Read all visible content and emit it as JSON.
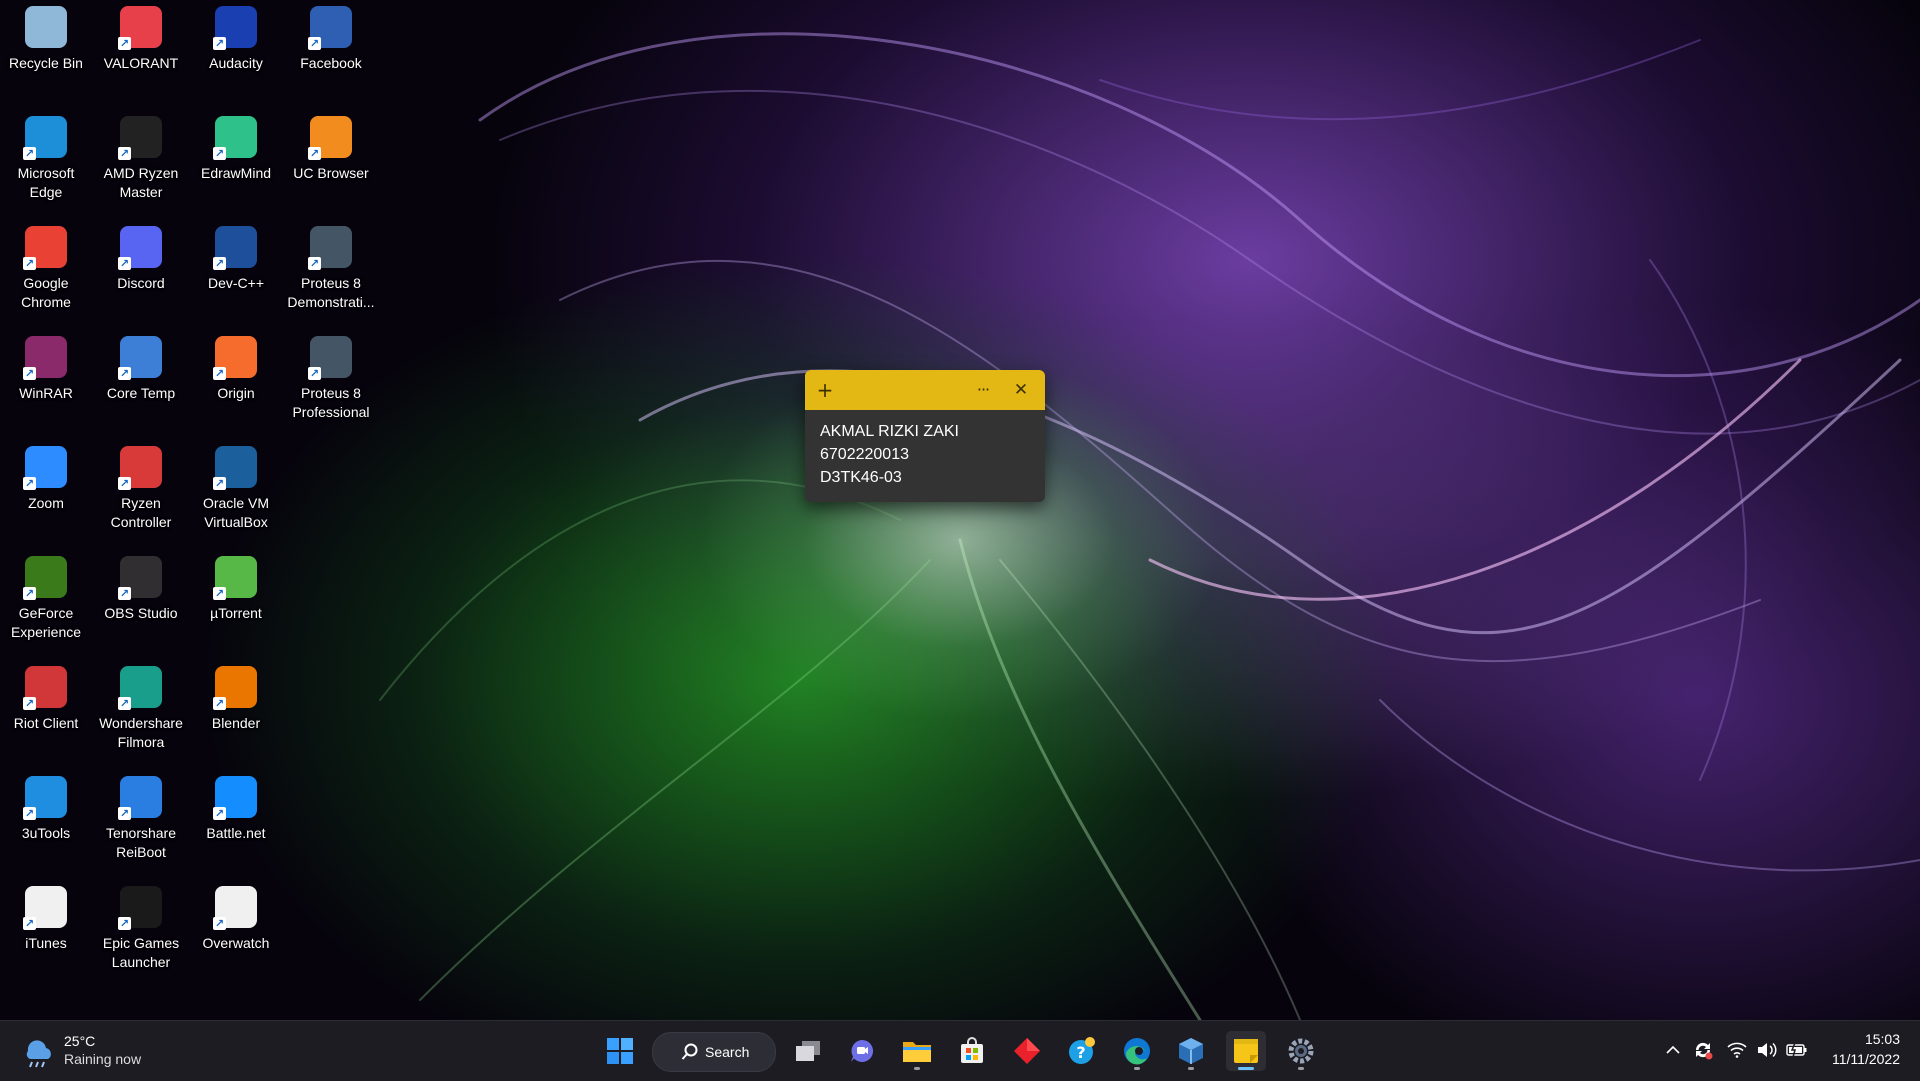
{
  "desktop": {
    "icons": [
      {
        "label": "Recycle Bin",
        "icon": "recycle-bin-icon",
        "color": "#8fb8d8"
      },
      {
        "label": "VALORANT",
        "icon": "valorant-icon",
        "color": "#e8404a"
      },
      {
        "label": "Audacity",
        "icon": "audacity-icon",
        "color": "#1a3fb0"
      },
      {
        "label": "Facebook",
        "icon": "facebook-icon",
        "color": "#2f5fb3"
      },
      {
        "label": "Microsoft Edge",
        "icon": "edge-icon",
        "color": "#1c8fd8"
      },
      {
        "label": "AMD Ryzen Master",
        "icon": "ryzen-master-icon",
        "color": "#222222"
      },
      {
        "label": "EdrawMind",
        "icon": "edrawmind-icon",
        "color": "#2ec28a"
      },
      {
        "label": "UC Browser",
        "icon": "uc-browser-icon",
        "color": "#f28c1e"
      },
      {
        "label": "Google Chrome",
        "icon": "chrome-icon",
        "color": "#e94235"
      },
      {
        "label": "Discord",
        "icon": "discord-icon",
        "color": "#5865f2"
      },
      {
        "label": "Dev-C++",
        "icon": "devcpp-icon",
        "color": "#1e4f9a"
      },
      {
        "label": "Proteus 8 Demonstrati...",
        "icon": "proteus-demo-icon",
        "color": "#445566"
      },
      {
        "label": "WinRAR",
        "icon": "winrar-icon",
        "color": "#8a2a6a"
      },
      {
        "label": "Core Temp",
        "icon": "core-temp-icon",
        "color": "#3d7fd6"
      },
      {
        "label": "Origin",
        "icon": "origin-icon",
        "color": "#f56c2d"
      },
      {
        "label": "Proteus 8 Professional",
        "icon": "proteus-pro-icon",
        "color": "#445566"
      },
      {
        "label": "Zoom",
        "icon": "zoom-icon",
        "color": "#2d8cff"
      },
      {
        "label": "Ryzen Controller",
        "icon": "ryzen-controller-icon",
        "color": "#d83a3a"
      },
      {
        "label": "Oracle VM VirtualBox",
        "icon": "virtualbox-icon",
        "color": "#1b5f9c"
      },
      {
        "label": "",
        "icon": "",
        "color": ""
      },
      {
        "label": "GeForce Experience",
        "icon": "geforce-icon",
        "color": "#3b7a1a"
      },
      {
        "label": "OBS Studio",
        "icon": "obs-icon",
        "color": "#302e31"
      },
      {
        "label": "µTorrent",
        "icon": "utorrent-icon",
        "color": "#58b847"
      },
      {
        "label": "",
        "icon": "",
        "color": ""
      },
      {
        "label": "Riot Client",
        "icon": "riot-client-icon",
        "color": "#d13639"
      },
      {
        "label": "Wondershare Filmora",
        "icon": "filmora-icon",
        "color": "#1a9e8c"
      },
      {
        "label": "Blender",
        "icon": "blender-icon",
        "color": "#ea7600"
      },
      {
        "label": "",
        "icon": "",
        "color": ""
      },
      {
        "label": "3uTools",
        "icon": "3utools-icon",
        "color": "#1f8de0"
      },
      {
        "label": "Tenorshare ReiBoot",
        "icon": "reiboot-icon",
        "color": "#2a7de1"
      },
      {
        "label": "Battle.net",
        "icon": "battlenet-icon",
        "color": "#148eff"
      },
      {
        "label": "",
        "icon": "",
        "color": ""
      },
      {
        "label": "iTunes",
        "icon": "itunes-icon",
        "color": "#f0f0f0"
      },
      {
        "label": "Epic Games Launcher",
        "icon": "epic-games-icon",
        "color": "#1a1a1a"
      },
      {
        "label": "Overwatch",
        "icon": "overwatch-icon",
        "color": "#f0f0f0"
      }
    ]
  },
  "sticky_note": {
    "line1": "AKMAL RIZKI ZAKI",
    "line2": "6702220013",
    "line3": "D3TK46-03",
    "add_glyph": "+",
    "menu_glyph": "···",
    "close_glyph": "✕",
    "header_color": "#e3b714"
  },
  "taskbar": {
    "weather": {
      "temp": "25°C",
      "condition": "Raining now"
    },
    "search_label": "Search",
    "pinned": [
      "windows-start-icon",
      "task-view-icon",
      "teams-chat-icon",
      "file-explorer-icon",
      "microsoft-store-icon",
      "red-diamond-app-icon",
      "get-help-icon",
      "edge-taskbar-icon",
      "virtualbox-taskbar-icon",
      "sticky-notes-icon",
      "settings-icon"
    ],
    "clock": {
      "time": "15:03",
      "date": "11/11/2022"
    }
  }
}
